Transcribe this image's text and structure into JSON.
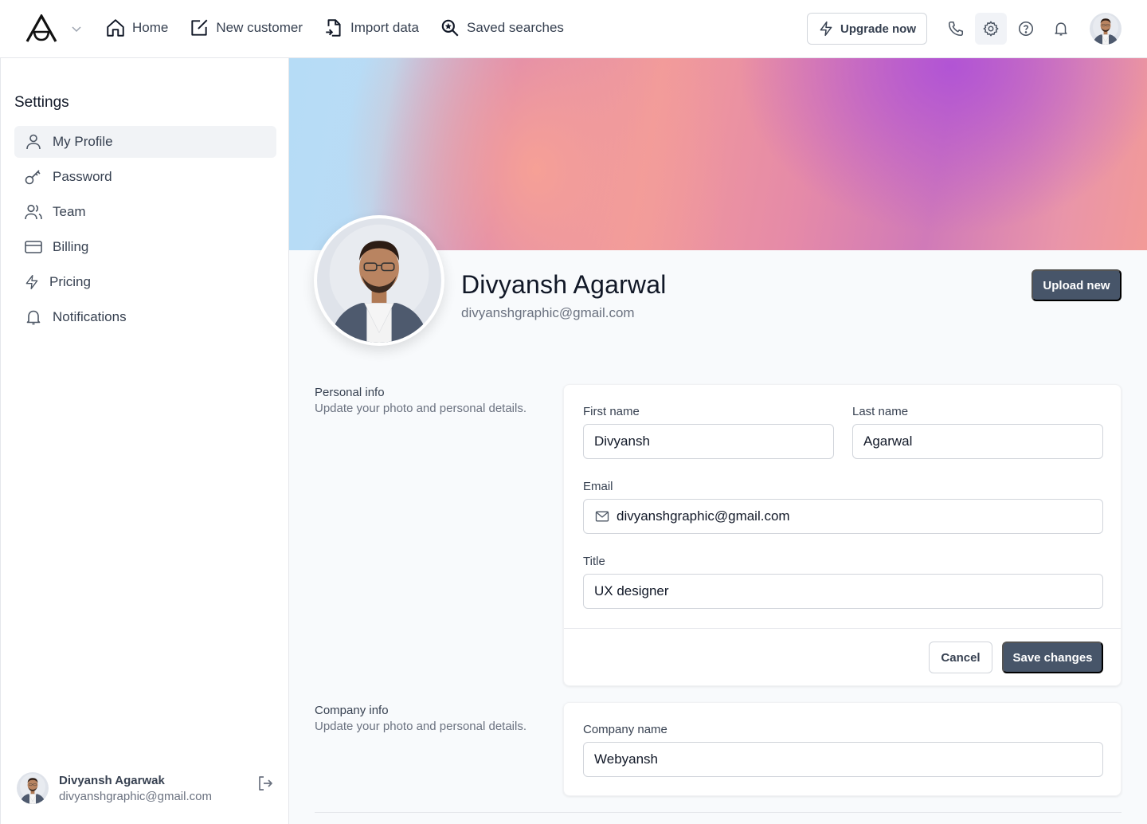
{
  "topbar": {
    "nav": [
      {
        "label": "Home",
        "icon": "home-icon"
      },
      {
        "label": "New customer",
        "icon": "edit-icon"
      },
      {
        "label": "Import data",
        "icon": "file-import-icon"
      },
      {
        "label": "Saved searches",
        "icon": "search-star-icon"
      }
    ],
    "upgrade_label": "Upgrade now",
    "icons": [
      "phone-icon",
      "gear-icon",
      "help-icon",
      "bell-icon"
    ]
  },
  "sidebar": {
    "title": "Settings",
    "items": [
      {
        "label": "My Profile",
        "icon": "user-icon",
        "active": true
      },
      {
        "label": "Password",
        "icon": "key-icon",
        "active": false
      },
      {
        "label": "Team",
        "icon": "users-icon",
        "active": false
      },
      {
        "label": "Billing",
        "icon": "credit-card-icon",
        "active": false
      },
      {
        "label": "Pricing",
        "icon": "lightning-icon",
        "active": false
      },
      {
        "label": "Notifications",
        "icon": "bell-icon",
        "active": false
      }
    ],
    "user": {
      "name": "Divyansh Agarwak",
      "email": "divyanshgraphic@gmail.com"
    }
  },
  "profile": {
    "name": "Divyansh Agarwal",
    "email": "divyanshgraphic@gmail.com",
    "upload_label": "Upload new"
  },
  "personal_info": {
    "title": "Personal info",
    "description": "Update your photo and personal details.",
    "first_name_label": "First name",
    "first_name": "Divyansh",
    "last_name_label": "Last name",
    "last_name": "Agarwal",
    "email_label": "Email",
    "email": "divyanshgraphic@gmail.com",
    "title_label": "Title",
    "job_title": "UX designer",
    "cancel_label": "Cancel",
    "save_label": "Save changes"
  },
  "company_info": {
    "title": "Company info",
    "description": "Update your photo and personal details.",
    "company_name_label": "Company name",
    "company_name": "Webyansh"
  },
  "colors": {
    "primary_button": "#475569",
    "active_sidebar": "#f1f3f6",
    "page_background": "#f8fafc"
  }
}
